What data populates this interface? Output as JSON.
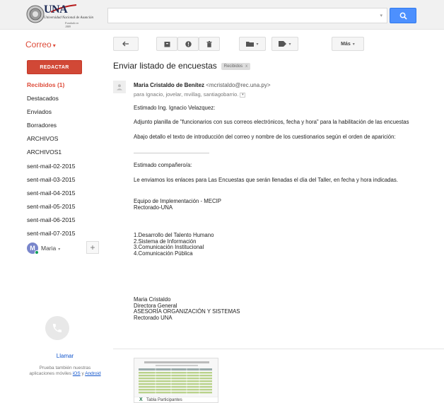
{
  "header": {
    "logo": {
      "text": "UNA",
      "subtitle": "Universidad Nacional de Asunción",
      "founded": "Fundada en 1889"
    },
    "search": {
      "value": "",
      "placeholder": ""
    },
    "search_button_icon": "search-icon"
  },
  "toolbar": {
    "app_label": "Correo",
    "more_label": "Más"
  },
  "sidebar": {
    "compose_label": "REDACTAR",
    "items": [
      {
        "label": "Recibidos (1)",
        "active": true
      },
      {
        "label": "Destacados"
      },
      {
        "label": "Enviados"
      },
      {
        "label": "Borradores"
      },
      {
        "label": "ARCHIVOS"
      },
      {
        "label": "ARCHIVOS1"
      },
      {
        "label": "sent-mail-02-2015"
      },
      {
        "label": "sent-mail-03-2015"
      },
      {
        "label": "sent-mail-04-2015"
      },
      {
        "label": "sent-mail-05-2015"
      },
      {
        "label": "sent-mail-06-2015"
      },
      {
        "label": "sent-mail-07-2015"
      }
    ],
    "hangouts": {
      "avatar_letter": "M",
      "user": "Maria"
    },
    "call_label": "Llamar",
    "promo": {
      "text": "Prueba también nuestras aplicaciones móviles",
      "ios": "iOS",
      "and": "y",
      "android": "Android"
    }
  },
  "message": {
    "subject": "Enviar listado de encuestas",
    "label_chip": "Recibidos",
    "label_chip_close": "x",
    "sender_name": "Maria Cristaldo de Benítez",
    "sender_email": "<mcristaldo@rec.una.py>",
    "recipients": "para Ignacio, jovelar, mvillag, santiagobarrio.",
    "body": {
      "greeting": "Estimado Ing. Ignacio Velazquez:",
      "p1": "Adjunto planilla de \"funcionarios con sus correos electrónicos, fecha y hora\" para la habilitación de las encuestas",
      "p2": "Abajo detallo el texto de introducción del correo y nombre de los cuestionarios según el orden de aparición:",
      "greeting2": "Estimado compañero/a:",
      "p3": "Le enviamos los enlaces para Las Encuestas que serán llenadas el día del Taller, en fecha y hora indicadas.",
      "team": [
        "Equipo de Implementación - MECIP",
        "Rectorado-UNA"
      ],
      "list": [
        "1.Desarrollo del Talento Humano",
        "2.Sistema de Información",
        "3.Comunicación Institucional",
        "4.Comunicación Pública"
      ],
      "signature": [
        "Maria Cristaldo",
        "Directora General",
        "ASESORÍA ORGANIZACIÓN Y SISTEMAS",
        "Rectorado UNA"
      ]
    },
    "attachment": {
      "title": "Tabla Participantes",
      "file_icon": "excel-icon"
    }
  },
  "colors": {
    "accent_red": "#dd4b39",
    "compose_red": "#d14836",
    "search_blue": "#4d90fe",
    "link_blue": "#1155cc",
    "online_green": "#0f9d58"
  }
}
